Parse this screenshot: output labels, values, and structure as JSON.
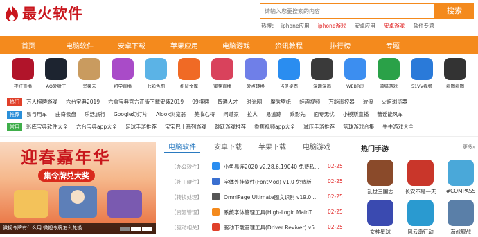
{
  "header": {
    "logo_text": "最火软件",
    "search_placeholder": "请输入您要搜索的内容",
    "search_button": "搜索",
    "hot_label": "热搜：",
    "hot_words": [
      "iphone应用",
      "iphone游戏",
      "安卓应用",
      "安卓游戏",
      "软件专题"
    ]
  },
  "nav": [
    "首页",
    "电脑软件",
    "安卓下载",
    "苹果应用",
    "电脑游戏",
    "资讯教程",
    "排行榜",
    "专题"
  ],
  "apps": [
    {
      "label": "夜红直播",
      "color": "#b1142a"
    },
    {
      "label": "AQ爱射工",
      "color": "#1d2430"
    },
    {
      "label": "坚果云",
      "color": "#c99b5f"
    },
    {
      "label": "初学直播",
      "color": "#a94bc8"
    },
    {
      "label": "七彩色图",
      "color": "#5bb3e6"
    },
    {
      "label": "松鼠文库",
      "color": "#f06a25"
    },
    {
      "label": "蜜芽直播",
      "color": "#d9425c"
    },
    {
      "label": "爱点转换",
      "color": "#6f7fe8"
    },
    {
      "label": "当贝桌面",
      "color": "#2a8df0"
    },
    {
      "label": "漫趣漫画",
      "color": "#3a3a3a"
    },
    {
      "label": "WEBR浏",
      "color": "#3c8ef0"
    },
    {
      "label": "骑猎游戏",
      "color": "#2aa148"
    },
    {
      "label": "51VV视频",
      "color": "#2a7ad9"
    },
    {
      "label": "看图看图",
      "color": "#333333"
    }
  ],
  "tag_rows": [
    {
      "tag": "热门",
      "color": "#e0402a",
      "words": [
        "万人棋牌游戏",
        "六台宝典2019",
        "六盒宝典官方正版下载安装2019",
        "99棋牌",
        "智通人才",
        "时光网",
        "魔秀壁纸",
        "蛙趣视频",
        "万能遥控器",
        "波浪",
        "火炬浏览器"
      ]
    },
    {
      "tag": "推荐",
      "color": "#2a8fd9",
      "words": [
        "易与用车",
        "曲奇云盘",
        "乐活旅行",
        "Google幻灯片",
        "Alook浏览器",
        "美收心得",
        "问道家",
        "拉人",
        "易追踪",
        "乘影先",
        "面专无忧",
        "小模斯直播",
        "蕾谣能风车"
      ]
    },
    {
      "tag": "常用",
      "color": "#3fae4a",
      "words": [
        "彩库宝典软件大全",
        "六台宝典app大全",
        "足球手游推荐",
        "宝宝巴士系列游戏",
        "跳跃游戏推荐",
        "香蕉视频app大全",
        "减压手游推荐",
        "篮球游戏合集",
        "牛牛游戏大全"
      ]
    }
  ],
  "banner": {
    "title": "迎春嘉年华",
    "subtitle": "集令牌兑大奖",
    "caption": "微视令牌有什么用 微视令牌怎么兑换"
  },
  "software": {
    "tabs": [
      "电脑软件",
      "安卓下载",
      "苹果下载",
      "电脑游戏"
    ],
    "rows": [
      {
        "cat": "【办公软件】",
        "name": "小鱼易连2020 v2.28.6.19040 免费私...",
        "date": "02-25",
        "color": "#2a8df0"
      },
      {
        "cat": "【补丁硬件】",
        "name": "字体外挂软件(FontMod) v1.0 免费版",
        "date": "02-25",
        "color": "#3a6fd0"
      },
      {
        "cat": "【转换处理】",
        "name": "OmniPage Ultimate图文识别 v19.0 ...",
        "date": "02-25",
        "color": "#555555"
      },
      {
        "cat": "【资源管理】",
        "name": "系统字体管理工具(High-Logic MainT...",
        "date": "02-25",
        "color": "#f48a1d"
      },
      {
        "cat": "【驱动相关】",
        "name": "驱动下载管理工具(Driver Reviver) v5....",
        "date": "02-25",
        "color": "#e0402a"
      }
    ]
  },
  "games": {
    "title": "热门手游",
    "more": "更多»",
    "items": [
      {
        "label": "乱世三国志",
        "color": "#8a4a2a"
      },
      {
        "label": "长安不是一天",
        "color": "#c9362a"
      },
      {
        "label": "#COMPASS",
        "color": "#4aa8d9"
      },
      {
        "label": "女神星球",
        "color": "#3a4ab0"
      },
      {
        "label": "风云岛行动",
        "color": "#2a9ad0"
      },
      {
        "label": "海战舰战",
        "color": "#5a7fa8"
      }
    ]
  }
}
